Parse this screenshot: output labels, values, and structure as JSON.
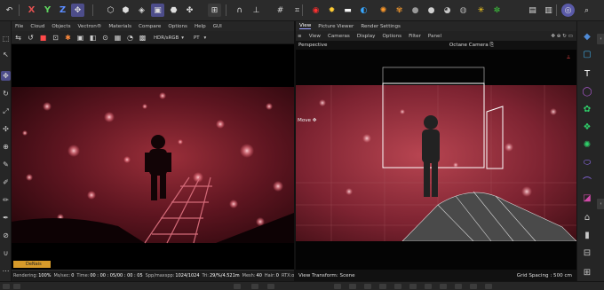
{
  "toolbar": {
    "axis_x": "X",
    "axis_y": "Y",
    "axis_z": "Z"
  },
  "left_panel": {
    "menu": [
      "File",
      "Cloud",
      "Objects",
      "Vectron®",
      "Materials",
      "Compare",
      "Options",
      "Help",
      "GUI"
    ],
    "color_space": "HDR/sRGB",
    "mode": "PT",
    "layer_badge": "DeNais",
    "status": {
      "rendering_label": "Rendering:",
      "rendering_value": "100%",
      "mssec_label": "Ms/sec:",
      "mssec_value": "0",
      "time_label": "Time:",
      "time_value": "00 : 00 : 05/00 : 00 : 05",
      "spp_label": "Spp/maxspp:",
      "spp_value": "1024/1024",
      "tri_label": "Tri:",
      "tri_value": "29/%/4.521m",
      "mesh_label": "Mesh:",
      "mesh_value": "40",
      "hair_label": "Hair:",
      "hair_value": "0",
      "rtx_label": "RTX:on"
    }
  },
  "right_panel": {
    "tabs": [
      "View",
      "Picture Viewer",
      "Render Settings"
    ],
    "menu": [
      "View",
      "Cameras",
      "Display",
      "Options",
      "Filter",
      "Panel"
    ],
    "camera_mode": "Perspective",
    "camera_name": "Octane Camera",
    "tool_label": "Move",
    "view_transform": "View Transform: Scene",
    "grid_spacing": "Grid Spacing : 500 cm"
  },
  "colors": {
    "accent": "#5a5aa8",
    "render_red": "#7a1a22",
    "badge": "#d69a2a"
  }
}
